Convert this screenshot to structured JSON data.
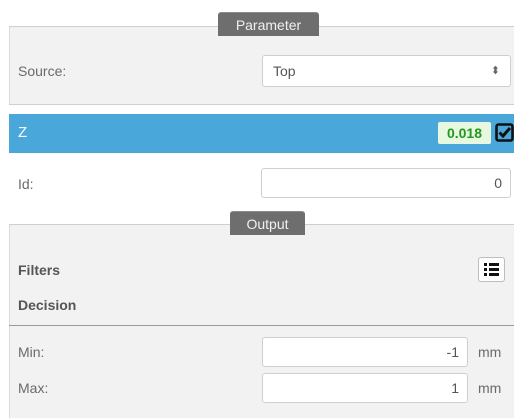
{
  "parameter_section": {
    "title": "Parameter",
    "source_label": "Source:",
    "source_value": "Top",
    "source_arrows": "⬍"
  },
  "z_row": {
    "label": "Z",
    "value": "0.018",
    "checked": true,
    "value_color": "#1f9a1f",
    "bar_color": "#4aa7d9"
  },
  "id_row": {
    "label": "Id:",
    "value": "0"
  },
  "output_section": {
    "title": "Output",
    "filters_label": "Filters",
    "decision_label": "Decision",
    "min_label": "Min:",
    "min_value": "-1",
    "min_unit": "mm",
    "max_label": "Max:",
    "max_value": "1",
    "max_unit": "mm",
    "filters_icon": "list-icon"
  }
}
